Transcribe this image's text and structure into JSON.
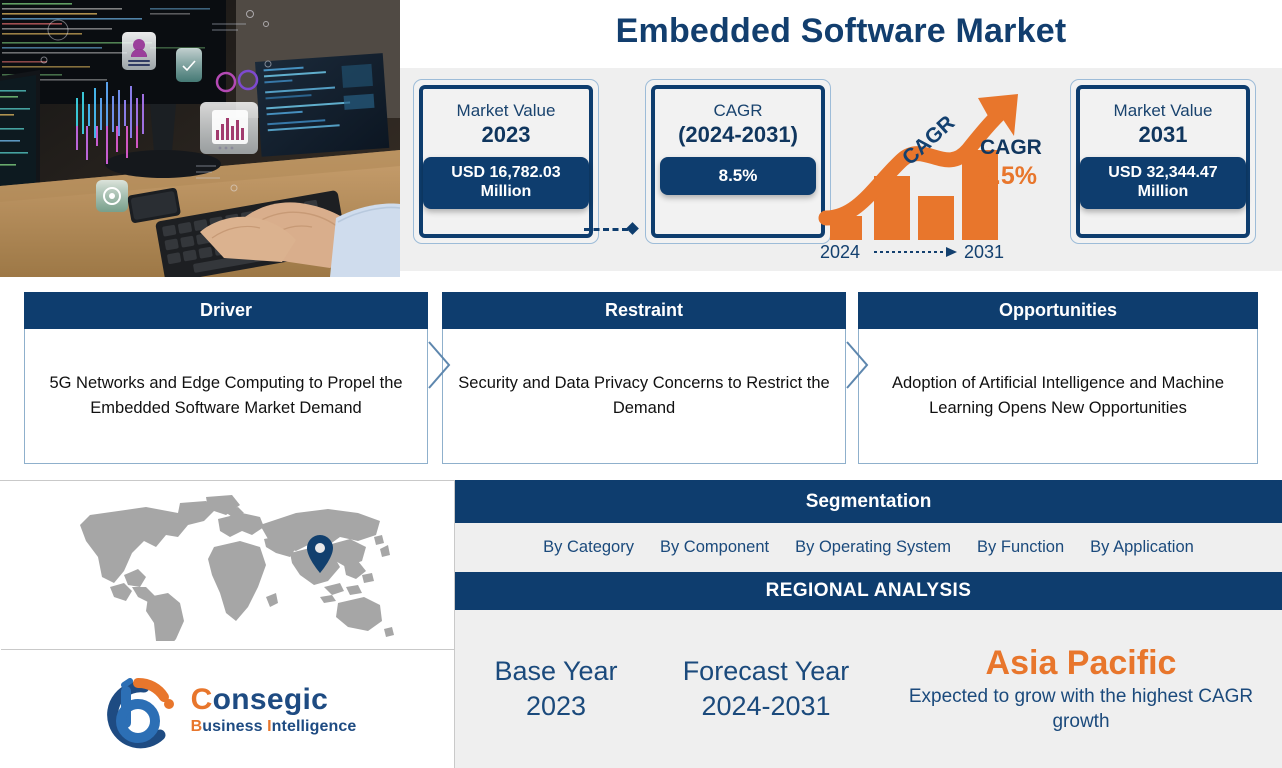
{
  "header": {
    "title": "Embedded Software Market"
  },
  "hero_image": {
    "alt": "person typing on keyboard with holographic data dashboards"
  },
  "kpi": {
    "cards": [
      {
        "label": "Market Value",
        "year": "2023",
        "value": "USD 16,782.03 Million"
      },
      {
        "label": "CAGR",
        "year": "(2024-2031)",
        "value": "8.5%"
      },
      {
        "label": "Market Value",
        "year": "2031",
        "value": "USD 32,344.47 Million"
      }
    ],
    "graphic": {
      "arrow_label": "CAGR",
      "start_year": "2024",
      "end_year": "2031",
      "cagr_label": "CAGR",
      "cagr_value": "8.5%"
    }
  },
  "panels": [
    {
      "title": "Driver",
      "text": "5G Networks and Edge Computing to Propel the Embedded Software Market Demand"
    },
    {
      "title": "Restraint",
      "text": "Security and Data Privacy Concerns to Restrict the Demand"
    },
    {
      "title": "Opportunities",
      "text": "Adoption of Artificial Intelligence and Machine Learning Opens New Opportunities"
    }
  ],
  "segmentation": {
    "title": "Segmentation",
    "items": [
      "By Category",
      "By Component",
      "By Operating System",
      "By Function",
      "By Application"
    ]
  },
  "regional": {
    "title": "REGIONAL ANALYSIS",
    "base_year_label": "Base Year",
    "base_year_value": "2023",
    "forecast_year_label": "Forecast Year",
    "forecast_year_value": "2024-2031",
    "highlight_region": "Asia Pacific",
    "highlight_note": "Expected to grow with the highest CAGR growth"
  },
  "logo": {
    "name_first": "C",
    "name_rest": "onsegic",
    "sub_b": "B",
    "sub_usiness": "usiness ",
    "sub_i": "I",
    "sub_ntelligence": "ntelligence"
  },
  "colors": {
    "navy": "#0E3D6E",
    "orange": "#E8762C",
    "light_gray": "#efefef",
    "map_gray": "#a6a6a6"
  }
}
